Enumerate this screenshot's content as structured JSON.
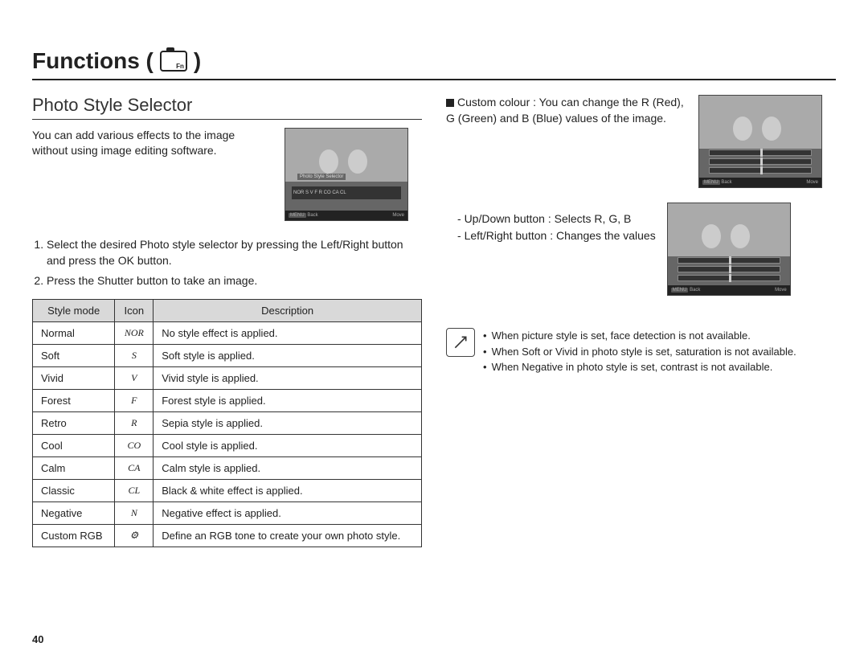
{
  "page_number": "40",
  "chapter": "Functions (",
  "chapter_close": ")",
  "cam_badge": "Fn",
  "section_title": "Photo Style Selector",
  "intro": "You can add various effects to the image without using image editing software.",
  "lcd1_label": "Photo Style Selector",
  "lcd_icons": "NOR  S  V  F  R  CO  CA  CL",
  "lcd_back": "Back",
  "lcd_move": "Move",
  "lcd_menu": "MENU",
  "steps": [
    "Select the desired Photo style selector by pressing the Left/Right button and press the OK button.",
    "Press the Shutter button to take an image."
  ],
  "table": {
    "headers": [
      "Style mode",
      "Icon",
      "Description"
    ],
    "rows": [
      [
        "Normal",
        "NOR",
        "No style effect is applied."
      ],
      [
        "Soft",
        "S",
        "Soft style is applied."
      ],
      [
        "Vivid",
        "V",
        "Vivid style is applied."
      ],
      [
        "Forest",
        "F",
        "Forest style is applied."
      ],
      [
        "Retro",
        "R",
        "Sepia style is applied."
      ],
      [
        "Cool",
        "CO",
        "Cool style is applied."
      ],
      [
        "Calm",
        "CA",
        "Calm style is applied."
      ],
      [
        "Classic",
        "CL",
        "Black & white effect is applied."
      ],
      [
        "Negative",
        "N",
        "Negative effect is applied."
      ],
      [
        "Custom RGB",
        "⚙",
        "Define an RGB tone to create your own photo style."
      ]
    ]
  },
  "custom_colour": "Custom colour : You can change the R (Red), G (Green) and B (Blue) values of the image.",
  "buttons": [
    "Up/Down button : Selects R, G, B",
    "Left/Right button : Changes the values"
  ],
  "notes": [
    "When picture style is set, face detection is not available.",
    "When Soft or Vivid in photo style is set, saturation is not available.",
    "When Negative in photo style is set, contrast is not available."
  ]
}
